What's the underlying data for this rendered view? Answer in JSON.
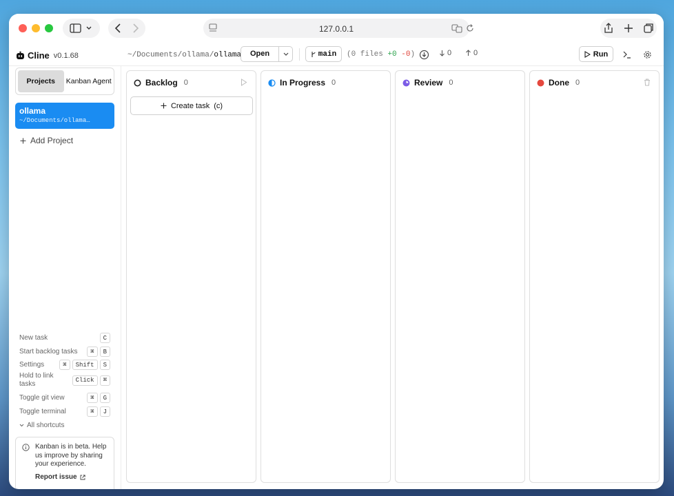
{
  "browser": {
    "url": "127.0.0.1"
  },
  "app": {
    "name": "Cline",
    "version": "v0.1.68"
  },
  "toolbar": {
    "path_prefix": "~/Documents/ollama/",
    "path_leaf": "ollama",
    "open_label": "Open",
    "branch": "main",
    "files_prefix": "(0 files ",
    "additions": "+0",
    "deletions": "-0",
    "files_suffix": ")",
    "behind": "0",
    "ahead": "0",
    "run_label": "Run"
  },
  "sidebar": {
    "tabs": [
      {
        "label": "Projects",
        "active": true
      },
      {
        "label": "Kanban Agent",
        "active": false
      }
    ],
    "projects": [
      {
        "name": "ollama",
        "path": "~/Documents/ollama…"
      }
    ],
    "add_project": "Add Project",
    "shortcuts": [
      {
        "label": "New task",
        "keys": [
          "C"
        ]
      },
      {
        "label": "Start backlog tasks",
        "keys": [
          "⌘",
          "B"
        ]
      },
      {
        "label": "Settings",
        "keys": [
          "⌘",
          "Shift",
          "S"
        ]
      },
      {
        "label": "Hold to link tasks",
        "keys": [
          "Click",
          "⌘"
        ]
      },
      {
        "label": "Toggle git view",
        "keys": [
          "⌘",
          "G"
        ]
      },
      {
        "label": "Toggle terminal",
        "keys": [
          "⌘",
          "J"
        ]
      }
    ],
    "all_shortcuts": "All shortcuts",
    "beta_notice": "Kanban is in beta. Help us improve by sharing your experience.",
    "report_issue": "Report issue"
  },
  "board": {
    "columns": [
      {
        "title": "Backlog",
        "count": "0",
        "color": "#222222"
      },
      {
        "title": "In Progress",
        "count": "0",
        "color": "#1a8cf2"
      },
      {
        "title": "Review",
        "count": "0",
        "color": "#7c5ce6"
      },
      {
        "title": "Done",
        "count": "0",
        "color": "#e5483e"
      }
    ],
    "create_task": "Create task",
    "create_task_shortcut": "(c)"
  }
}
